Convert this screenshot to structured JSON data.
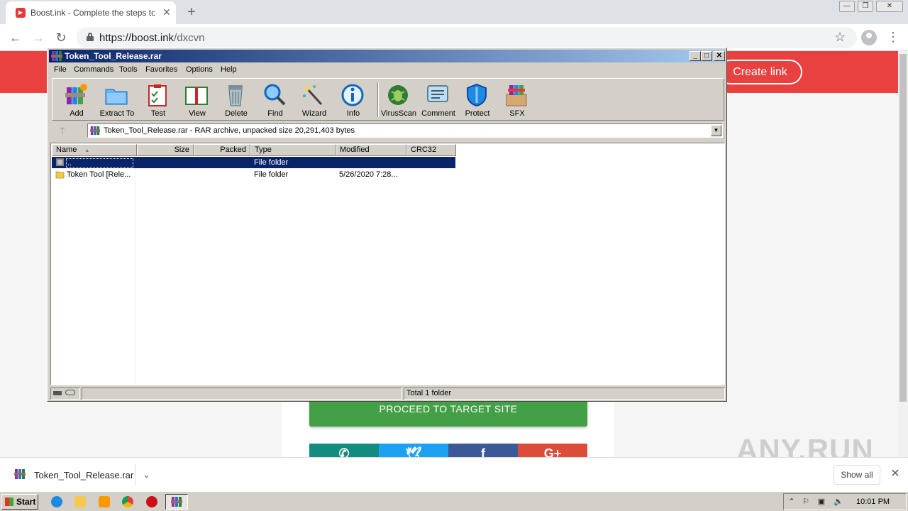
{
  "browser": {
    "tab_title": "Boost.ink - Complete the steps to proceed",
    "tab_close": "✕",
    "new_tab": "+",
    "window_controls": [
      "—",
      "❐",
      "✕"
    ],
    "nav": {
      "back": "←",
      "forward": "→",
      "reload": "↻"
    },
    "url_host": "https://boost.ink",
    "url_path": "/dxcvn",
    "star": "☆",
    "menu": "⋮"
  },
  "page": {
    "create_link": "Create link",
    "proceed_button": "PROCEED TO TARGET SITE",
    "share_buttons": [
      {
        "icon": "whatsapp-icon",
        "glyph": "✆",
        "color": "#128c7e"
      },
      {
        "icon": "twitter-icon",
        "glyph": "🕊",
        "color": "#1da1f2"
      },
      {
        "icon": "facebook-icon",
        "glyph": "f",
        "color": "#3b5998"
      },
      {
        "icon": "google-plus-icon",
        "glyph": "G+",
        "color": "#dd4b39"
      }
    ],
    "banner_color": "#e94040",
    "proceed_color": "#43a047"
  },
  "watermark": "ANY.RUN",
  "download_shelf": {
    "file_name": "Token_Tool_Release.rar",
    "chevron": "⌄",
    "show_all": "Show all",
    "close": "✕"
  },
  "winrar": {
    "title": "Token_Tool_Release.rar",
    "caption_buttons": [
      "_",
      "□",
      "✕"
    ],
    "menu": [
      "File",
      "Commands",
      "Tools",
      "Favorites",
      "Options",
      "Help"
    ],
    "tools": [
      {
        "label": "Add",
        "icon": "add-archive-icon"
      },
      {
        "label": "Extract To",
        "icon": "extract-folder-icon"
      },
      {
        "label": "Test",
        "icon": "test-clipboard-icon"
      },
      {
        "label": "View",
        "icon": "view-book-icon"
      },
      {
        "label": "Delete",
        "icon": "delete-bin-icon"
      },
      {
        "label": "Find",
        "icon": "find-magnifier-icon"
      },
      {
        "label": "Wizard",
        "icon": "wizard-wand-icon"
      },
      {
        "label": "Info",
        "icon": "info-icon"
      },
      {
        "label": "VirusScan",
        "icon": "virusscan-bug-icon"
      },
      {
        "label": "Comment",
        "icon": "comment-icon"
      },
      {
        "label": "Protect",
        "icon": "protect-shield-icon"
      },
      {
        "label": "SFX",
        "icon": "sfx-box-icon"
      }
    ],
    "up_glyph": "🡑",
    "path_text": "Token_Tool_Release.rar - RAR archive, unpacked size 20,291,403 bytes",
    "columns": [
      "Name",
      "Size",
      "Packed",
      "Type",
      "Modified",
      "CRC32"
    ],
    "sort_indicator": "▲",
    "rows": [
      {
        "name": "..",
        "size": "",
        "packed": "",
        "type": "File folder",
        "modified": "",
        "crc": "",
        "selected": true
      },
      {
        "name": "Token Tool [Rele...",
        "size": "",
        "packed": "",
        "type": "File folder",
        "modified": "5/26/2020 7:28...",
        "crc": "",
        "selected": false
      }
    ],
    "status_text": "Total 1 folder"
  },
  "taskbar": {
    "start_label": "Start",
    "clock": "10:01 PM"
  }
}
